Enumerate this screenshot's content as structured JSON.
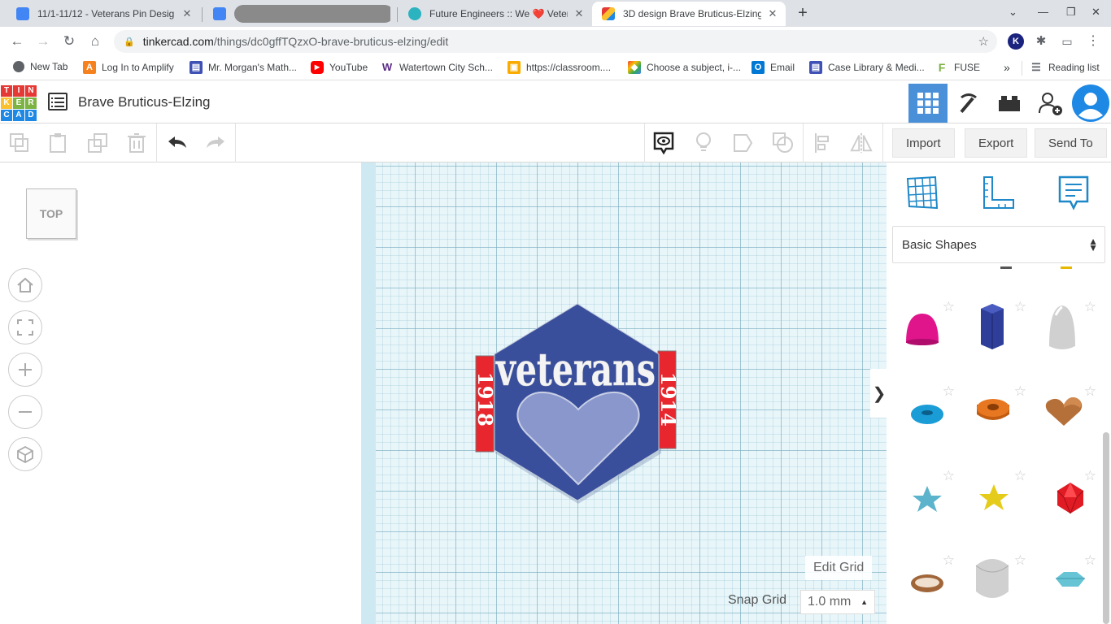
{
  "browser": {
    "tabs": [
      {
        "title": "11/1-11/12 - Veterans Pin Desig",
        "favicon_color": "#4285f4"
      },
      {
        "title": "",
        "favicon_color": "#4285f4"
      },
      {
        "title": "Future Engineers :: We ❤️ Vetera",
        "favicon_color": "#2bb3c0"
      },
      {
        "title": "3D design Brave Bruticus-Elzing",
        "favicon_color": "#e53935"
      }
    ],
    "url_host": "tinkercad.com",
    "url_path": "/things/dc0gffTQzxO-brave-bruticus-elzing/edit",
    "bookmarks": [
      {
        "label": "New Tab",
        "icon": "globe-icon",
        "color": "#777777"
      },
      {
        "label": "Log In to Amplify",
        "icon": "amplify-icon",
        "color": "#f5821f"
      },
      {
        "label": "Mr. Morgan's Math...",
        "icon": "forms-icon",
        "color": "#3f51b5"
      },
      {
        "label": "YouTube",
        "icon": "youtube-icon",
        "color": "#ff0000"
      },
      {
        "label": "Watertown City Sch...",
        "icon": "w-icon",
        "color": "#5b2a86"
      },
      {
        "label": "https://classroom....",
        "icon": "classroom-icon",
        "color": "#f9ab00"
      },
      {
        "label": "Choose a subject, i-...",
        "icon": "cube-icon",
        "color": "#34a853"
      },
      {
        "label": "Email",
        "icon": "outlook-icon",
        "color": "#0078d4"
      },
      {
        "label": "Case Library & Medi...",
        "icon": "forms-icon",
        "color": "#3f51b5"
      },
      {
        "label": "FUSE",
        "icon": "fuse-icon",
        "color": "#7cb342"
      }
    ],
    "reading_list": "Reading list"
  },
  "app": {
    "logo_letters": [
      "T",
      "I",
      "N",
      "K",
      "E",
      "R",
      "C",
      "A",
      "D"
    ],
    "design_title": "Brave Bruticus-Elzing"
  },
  "toolbar": {
    "import_label": "Import",
    "export_label": "Export",
    "sendto_label": "Send To"
  },
  "viewcube": {
    "label": "TOP"
  },
  "workplane": {
    "edit_grid_label": "Edit Grid",
    "snap_grid_label": "Snap Grid",
    "snap_grid_value": "1.0 mm"
  },
  "design": {
    "word": "veterans",
    "year_left": "1918",
    "year_right": "1914",
    "hex_color": "#3a4f9c",
    "heart_color": "#8a97cc",
    "band_color": "#e8262e"
  },
  "shapes_panel": {
    "category": "Basic Shapes",
    "shapes": [
      {
        "name": "half-sphere",
        "color": "#e0158c"
      },
      {
        "name": "polygon",
        "color": "#2e3e99"
      },
      {
        "name": "paraboloid",
        "color": "#cfcfcf"
      },
      {
        "name": "torus",
        "color": "#1a9cd6"
      },
      {
        "name": "tube",
        "color": "#e87722"
      },
      {
        "name": "heart",
        "color": "#b5703a"
      },
      {
        "name": "star-blue",
        "color": "#5cb3cc"
      },
      {
        "name": "star-yellow",
        "color": "#e6cc1a"
      },
      {
        "name": "icosahedron",
        "color": "#e01b24"
      },
      {
        "name": "ring",
        "color": "#a0663a"
      },
      {
        "name": "round-roof",
        "color": "#d0d0d0"
      },
      {
        "name": "diamond",
        "color": "#66c4d4"
      }
    ]
  }
}
